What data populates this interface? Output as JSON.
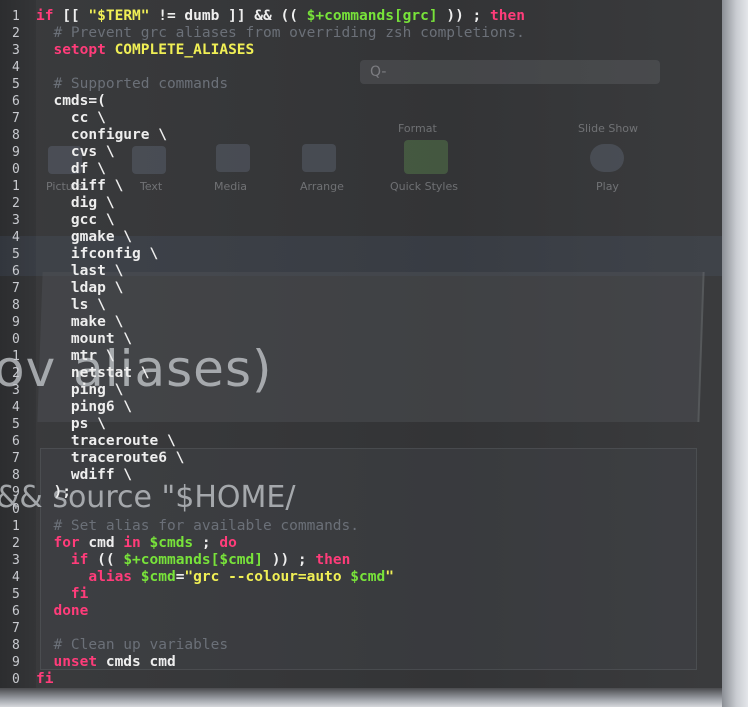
{
  "background": {
    "ribbon": {
      "search_prefix": "Q-",
      "format_label": "Format",
      "slide_show_label": "Slide Show",
      "items": [
        "Picture",
        "Text",
        "Media",
        "Arrange",
        "Quick Styles",
        "Play"
      ]
    },
    "heading_fragment": "ov aliases)",
    "source_fragment": "&& source \"$HOME/"
  },
  "terminal": {
    "lines": [
      {
        "n": "1",
        "parts": [
          {
            "t": "if ",
            "c": "m"
          },
          {
            "t": "[[ ",
            "c": "w"
          },
          {
            "t": "\"$TERM\"",
            "c": "y"
          },
          {
            "t": " != dumb ]] && (( ",
            "c": "w"
          },
          {
            "t": "$+commands[grc]",
            "c": "g"
          },
          {
            "t": " )) ; ",
            "c": "w"
          },
          {
            "t": "then",
            "c": "m"
          }
        ]
      },
      {
        "n": "2",
        "parts": [
          {
            "t": "  # Prevent grc aliases from overriding zsh completions.",
            "c": "c"
          }
        ]
      },
      {
        "n": "3",
        "parts": [
          {
            "t": "  setopt ",
            "c": "m"
          },
          {
            "t": "COMPLETE_ALIASES",
            "c": "y"
          }
        ]
      },
      {
        "n": "4",
        "parts": []
      },
      {
        "n": "5",
        "parts": [
          {
            "t": "  # Supported commands",
            "c": "c"
          }
        ]
      },
      {
        "n": "6",
        "parts": [
          {
            "t": "  cmds=(",
            "c": "w"
          }
        ]
      },
      {
        "n": "7",
        "parts": [
          {
            "t": "    cc \\",
            "c": "w"
          }
        ]
      },
      {
        "n": "8",
        "parts": [
          {
            "t": "    configure \\",
            "c": "w"
          }
        ]
      },
      {
        "n": "9",
        "parts": [
          {
            "t": "    cvs \\",
            "c": "w"
          }
        ]
      },
      {
        "n": "0",
        "parts": [
          {
            "t": "    df \\",
            "c": "w"
          }
        ]
      },
      {
        "n": "1",
        "parts": [
          {
            "t": "    diff \\",
            "c": "w"
          }
        ]
      },
      {
        "n": "2",
        "parts": [
          {
            "t": "    dig \\",
            "c": "w"
          }
        ]
      },
      {
        "n": "3",
        "parts": [
          {
            "t": "    gcc \\",
            "c": "w"
          }
        ]
      },
      {
        "n": "4",
        "parts": [
          {
            "t": "    gmake \\",
            "c": "w"
          }
        ]
      },
      {
        "n": "5",
        "parts": [
          {
            "t": "    ifconfig \\",
            "c": "w"
          }
        ]
      },
      {
        "n": "6",
        "parts": [
          {
            "t": "    last \\",
            "c": "w"
          }
        ]
      },
      {
        "n": "7",
        "parts": [
          {
            "t": "    ldap \\",
            "c": "w"
          }
        ]
      },
      {
        "n": "8",
        "parts": [
          {
            "t": "    ls \\",
            "c": "w"
          }
        ]
      },
      {
        "n": "9",
        "parts": [
          {
            "t": "    make \\",
            "c": "w"
          }
        ]
      },
      {
        "n": "0",
        "parts": [
          {
            "t": "    mount \\",
            "c": "w"
          }
        ]
      },
      {
        "n": "1",
        "parts": [
          {
            "t": "    mtr \\",
            "c": "w"
          }
        ]
      },
      {
        "n": "2",
        "parts": [
          {
            "t": "    netstat \\",
            "c": "w"
          }
        ]
      },
      {
        "n": "3",
        "parts": [
          {
            "t": "    ping \\",
            "c": "w"
          }
        ]
      },
      {
        "n": "4",
        "parts": [
          {
            "t": "    ping6 \\",
            "c": "w"
          }
        ]
      },
      {
        "n": "5",
        "parts": [
          {
            "t": "    ps \\",
            "c": "w"
          }
        ]
      },
      {
        "n": "6",
        "parts": [
          {
            "t": "    traceroute \\",
            "c": "w"
          }
        ]
      },
      {
        "n": "7",
        "parts": [
          {
            "t": "    traceroute6 \\",
            "c": "w"
          }
        ]
      },
      {
        "n": "8",
        "parts": [
          {
            "t": "    wdiff \\",
            "c": "w"
          }
        ]
      },
      {
        "n": "9",
        "parts": [
          {
            "t": "  );",
            "c": "w"
          }
        ]
      },
      {
        "n": "0",
        "parts": []
      },
      {
        "n": "1",
        "parts": [
          {
            "t": "  # Set alias for available commands.",
            "c": "c"
          }
        ]
      },
      {
        "n": "2",
        "parts": [
          {
            "t": "  for ",
            "c": "m"
          },
          {
            "t": "cmd ",
            "c": "w"
          },
          {
            "t": "in ",
            "c": "m"
          },
          {
            "t": "$cmds",
            "c": "g"
          },
          {
            "t": " ; ",
            "c": "w"
          },
          {
            "t": "do",
            "c": "m"
          }
        ]
      },
      {
        "n": "3",
        "parts": [
          {
            "t": "    if ",
            "c": "m"
          },
          {
            "t": "(( ",
            "c": "w"
          },
          {
            "t": "$+commands[$cmd]",
            "c": "g"
          },
          {
            "t": " )) ; ",
            "c": "w"
          },
          {
            "t": "then",
            "c": "m"
          }
        ]
      },
      {
        "n": "4",
        "parts": [
          {
            "t": "      alias ",
            "c": "m"
          },
          {
            "t": "$cmd",
            "c": "g"
          },
          {
            "t": "=",
            "c": "w"
          },
          {
            "t": "\"grc --colour=auto ",
            "c": "y"
          },
          {
            "t": "$cmd",
            "c": "g"
          },
          {
            "t": "\"",
            "c": "y"
          }
        ]
      },
      {
        "n": "5",
        "parts": [
          {
            "t": "    fi",
            "c": "m"
          }
        ]
      },
      {
        "n": "6",
        "parts": [
          {
            "t": "  done",
            "c": "m"
          }
        ]
      },
      {
        "n": "7",
        "parts": []
      },
      {
        "n": "8",
        "parts": [
          {
            "t": "  # Clean up variables",
            "c": "c"
          }
        ]
      },
      {
        "n": "9",
        "parts": [
          {
            "t": "  unset ",
            "c": "m"
          },
          {
            "t": "cmds cmd",
            "c": "w"
          }
        ]
      },
      {
        "n": "0",
        "parts": [
          {
            "t": "fi",
            "c": "m"
          }
        ]
      }
    ]
  }
}
